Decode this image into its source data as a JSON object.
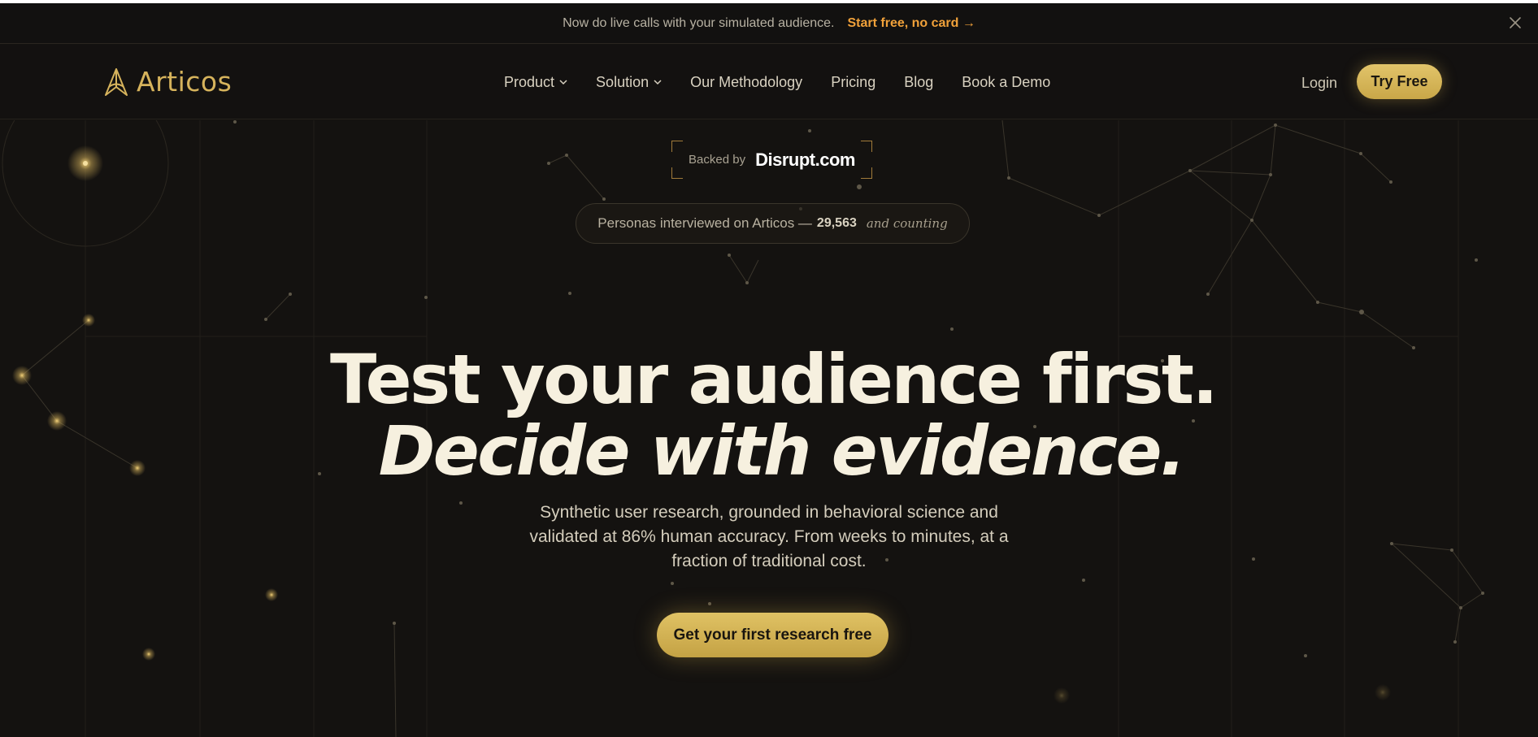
{
  "announcement": {
    "message": "Now do live calls with your simulated audience.",
    "cta": "Start free, no card →",
    "close_icon": "close-icon"
  },
  "nav": {
    "logo_text": "Articos",
    "logo_icon": "articos-logo-icon",
    "items": [
      {
        "label": "Product",
        "has_dropdown": true
      },
      {
        "label": "Solution",
        "has_dropdown": true
      },
      {
        "label": "Our Methodology",
        "has_dropdown": false
      },
      {
        "label": "Pricing",
        "has_dropdown": false
      },
      {
        "label": "Blog",
        "has_dropdown": false
      },
      {
        "label": "Book a Demo",
        "has_dropdown": false
      }
    ],
    "login": "Login",
    "try_free": "Try Free"
  },
  "hero": {
    "backed_label": "Backed by",
    "backed_brand": "Disrupt.com",
    "counter_text": "Personas interviewed on Articos —",
    "counter_value": "29,563",
    "counter_tail": "and counting",
    "headline_line1": "Test your audience first.",
    "headline_line2": "Decide with evidence.",
    "subtitle": "Synthetic user research, grounded in behavioral science and validated at 86% human accuracy. From weeks to minutes, at a fraction of traditional cost.",
    "cta": "Get your first research free"
  },
  "colors": {
    "background": "#141210",
    "accent_gold": "#d6b35c",
    "announcement_cta": "#f0a13a",
    "headline": "#f6f0df"
  }
}
